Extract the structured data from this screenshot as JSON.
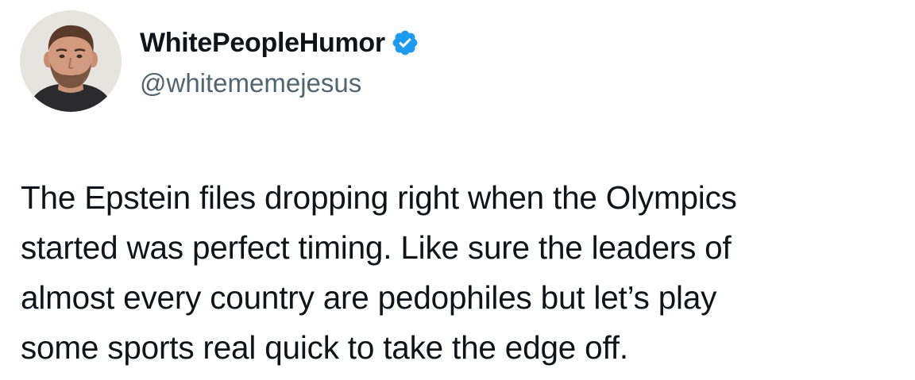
{
  "author": {
    "display_name": "WhitePeopleHumor",
    "handle": "@whitememejesus",
    "verified": true,
    "avatar_icon": "profile-photo",
    "verified_icon": "verified-badge-icon"
  },
  "tweet": {
    "lines": [
      "The Epstein files dropping right when the Olympics",
      "started was perfect timing. Like sure the leaders of",
      "almost every country are pedophiles but let’s play",
      "some sports real quick to take the edge off."
    ]
  },
  "colors": {
    "text": "#0f1419",
    "secondary_text": "#536471",
    "verified_badge": "#1d9bf0",
    "background": "#ffffff"
  }
}
